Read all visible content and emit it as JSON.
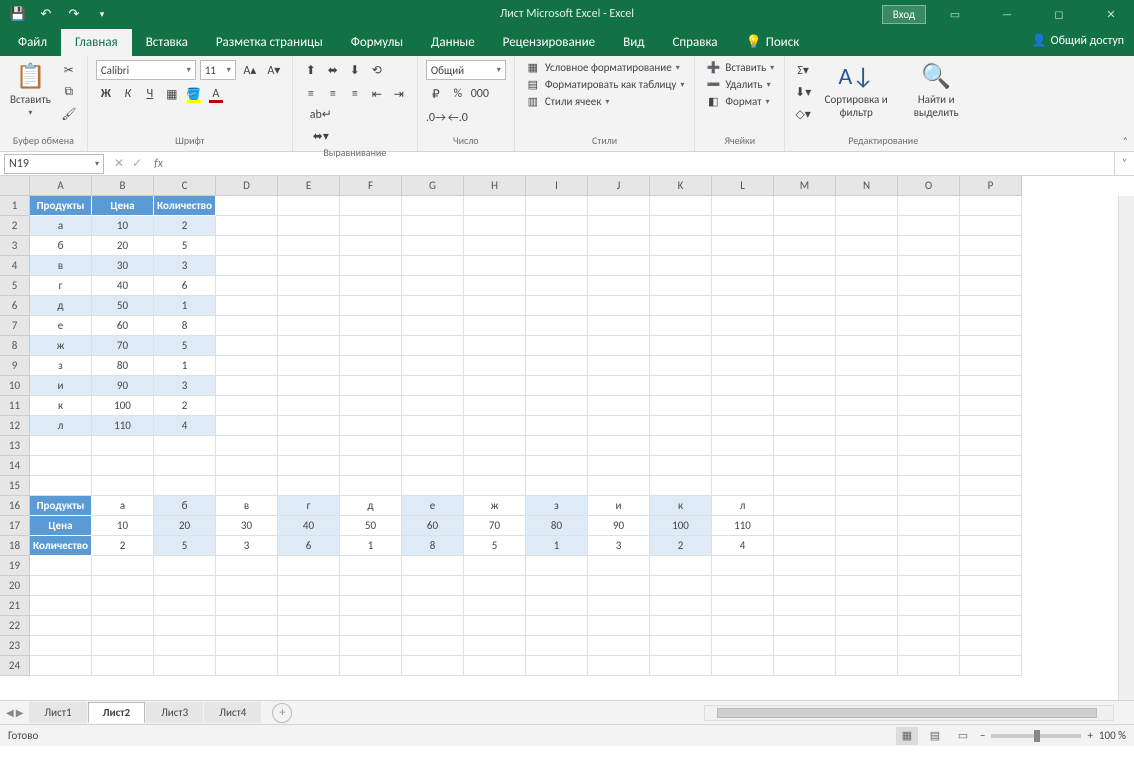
{
  "title": "Лист Microsoft Excel  -  Excel",
  "login": "Вход",
  "tabs": {
    "file": "Файл",
    "home": "Главная",
    "insert": "Вставка",
    "layout": "Разметка страницы",
    "formulas": "Формулы",
    "data": "Данные",
    "review": "Рецензирование",
    "view": "Вид",
    "help": "Справка",
    "search": "Поиск"
  },
  "share": "Общий доступ",
  "clipboard": {
    "paste": "Вставить",
    "label": "Буфер обмена"
  },
  "font": {
    "name": "Calibri",
    "size": "11",
    "label": "Шрифт",
    "bold": "Ж",
    "italic": "К",
    "underline": "Ч"
  },
  "align": {
    "label": "Выравнивание"
  },
  "number": {
    "format": "Общий",
    "label": "Число"
  },
  "styles": {
    "cond": "Условное форматирование",
    "table": "Форматировать как таблицу",
    "cell": "Стили ячеек",
    "label": "Стили"
  },
  "cells": {
    "insert": "Вставить",
    "delete": "Удалить",
    "format": "Формат",
    "label": "Ячейки"
  },
  "editing": {
    "sort": "Сортировка и фильтр",
    "find": "Найти и выделить",
    "label": "Редактирование"
  },
  "namebox": "N19",
  "columns": [
    "A",
    "B",
    "C",
    "D",
    "E",
    "F",
    "G",
    "H",
    "I",
    "J",
    "K",
    "L",
    "M",
    "N",
    "O",
    "P"
  ],
  "t1": {
    "hdr": [
      "Продукты",
      "Цена",
      "Количество"
    ],
    "rows": [
      [
        "а",
        "10",
        "2"
      ],
      [
        "б",
        "20",
        "5"
      ],
      [
        "в",
        "30",
        "3"
      ],
      [
        "г",
        "40",
        "6"
      ],
      [
        "д",
        "50",
        "1"
      ],
      [
        "е",
        "60",
        "8"
      ],
      [
        "ж",
        "70",
        "5"
      ],
      [
        "з",
        "80",
        "1"
      ],
      [
        "и",
        "90",
        "3"
      ],
      [
        "к",
        "100",
        "2"
      ],
      [
        "л",
        "110",
        "4"
      ]
    ]
  },
  "t2": {
    "labels": [
      "Продукты",
      "Цена",
      "Количество"
    ],
    "products": [
      "а",
      "б",
      "в",
      "г",
      "д",
      "е",
      "ж",
      "з",
      "и",
      "к",
      "л"
    ],
    "prices": [
      "10",
      "20",
      "30",
      "40",
      "50",
      "60",
      "70",
      "80",
      "90",
      "100",
      "110"
    ],
    "qty": [
      "2",
      "5",
      "3",
      "6",
      "1",
      "8",
      "5",
      "1",
      "3",
      "2",
      "4"
    ]
  },
  "sheets": [
    "Лист1",
    "Лист2",
    "Лист3",
    "Лист4"
  ],
  "active_sheet": 1,
  "status": "Готово",
  "zoom": "100 %"
}
